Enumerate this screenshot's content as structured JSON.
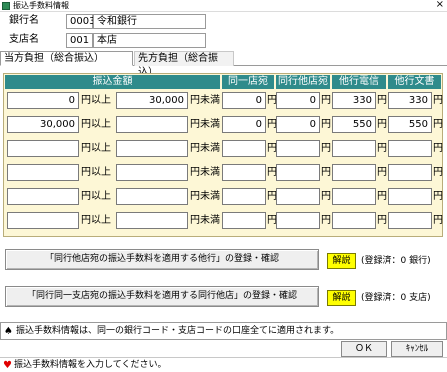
{
  "window": {
    "title": "振込手数料情報",
    "close_glyph": "×",
    "app_icon": "app-icon"
  },
  "bank": {
    "label": "銀行名",
    "code": "0003",
    "name": "令和銀行"
  },
  "branch": {
    "label": "支店名",
    "code": "001",
    "name": "本店"
  },
  "tabs": [
    {
      "label": "当方負担（総合振込）",
      "active": true
    },
    {
      "label": "先方負担（総合振込）",
      "active": false
    }
  ],
  "table": {
    "headers": [
      "振込金額",
      "同一店宛",
      "同行他店宛",
      "他行電信",
      "他行文書"
    ],
    "units": {
      "from": "円以上",
      "to": "円未満",
      "yen": "円"
    },
    "rows": [
      {
        "from": "0",
        "to": "30,000",
        "same_branch": "0",
        "same_bank": "0",
        "other_tel": "330",
        "other_doc": "330"
      },
      {
        "from": "30,000",
        "to": "",
        "same_branch": "0",
        "same_bank": "0",
        "other_tel": "550",
        "other_doc": "550"
      },
      {
        "from": "",
        "to": "",
        "same_branch": "",
        "same_bank": "",
        "other_tel": "",
        "other_doc": ""
      },
      {
        "from": "",
        "to": "",
        "same_branch": "",
        "same_bank": "",
        "other_tel": "",
        "other_doc": ""
      },
      {
        "from": "",
        "to": "",
        "same_branch": "",
        "same_bank": "",
        "other_tel": "",
        "other_doc": ""
      },
      {
        "from": "",
        "to": "",
        "same_branch": "",
        "same_bank": "",
        "other_tel": "",
        "other_doc": ""
      }
    ]
  },
  "registrations": [
    {
      "button": "「同行他店宛の振込手数料を適用する他行」の登録・確認",
      "help": "解説",
      "note": "(登録済：0 銀行)"
    },
    {
      "button": "「同行同一支店宛の振込手数料を適用する同行他店」の登録・確認",
      "help": "解説",
      "note": "(登録済：0 支店)"
    }
  ],
  "info": {
    "glyph": "♠",
    "text": "振込手数料情報は、同一の銀行コード・支店コードの口座全てに適用されます。"
  },
  "buttons": {
    "ok": "ＯＫ",
    "cancel": "ｷｬﾝｾﾙ"
  },
  "status": {
    "glyph": "♥",
    "text": "振込手数料情報を入力してください。"
  },
  "colors": {
    "header_bg": "#2f8b8b",
    "grid_bg": "#fdf7d6",
    "help_bg": "#ffff00",
    "heart": "#e00000"
  }
}
